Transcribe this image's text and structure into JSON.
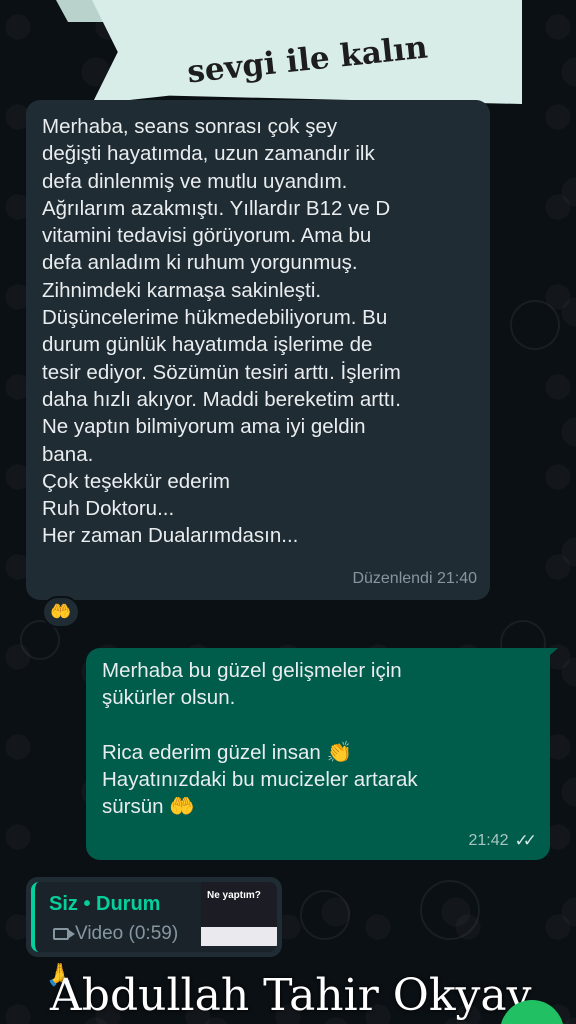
{
  "banner": {
    "text": "sevgi ile kalın"
  },
  "incoming_message": {
    "lines": [
      "Merhaba, seans sonrası çok şey",
      "değişti hayatımda, uzun zamandır ilk",
      "defa dinlenmiş ve mutlu uyandım.",
      "Ağrılarım azakmıştı. Yıllardır B12 ve D",
      "vitamini tedavisi görüyorum. Ama bu",
      "defa anladım ki ruhum yorgunmuş.",
      "Zihnimdeki karmaşa sakinleşti.",
      "Düşüncelerime hükmedebiliyorum. Bu",
      "durum günlük hayatımda işlerime de",
      "tesir ediyor. Sözümün tesiri arttı. İşlerim",
      "daha hızlı akıyor. Maddi bereketim arttı.",
      "Ne yaptın bilmiyorum ama iyi geldin",
      "bana.",
      "Çok teşekkür ederim",
      "Ruh Doktoru...",
      "Her zaman Dualarımdasın..."
    ],
    "meta": "Düzenlendi 21:40",
    "reaction": "🤲"
  },
  "outgoing_message": {
    "lines": [
      "Merhaba bu güzel gelişmeler için",
      "şükürler olsun.",
      "",
      "Rica ederim güzel insan 👏",
      "Hayatınızdaki bu mucizeler artarak",
      "sürsün 🤲"
    ],
    "time": "21:42",
    "ticks": "✓✓"
  },
  "status_reply": {
    "title": "Siz • Durum",
    "subtitle": "Video (0:59)",
    "thumbnail_title": "Ne yaptım?"
  },
  "footer": {
    "name": "Abdullah Tahir Okyay",
    "emoji": "🙏"
  },
  "colors": {
    "background": "#0b1014",
    "incoming_bubble": "#202c33",
    "outgoing_bubble": "#005c4b",
    "accent": "#06cf9c",
    "banner": "#d8ede8"
  }
}
